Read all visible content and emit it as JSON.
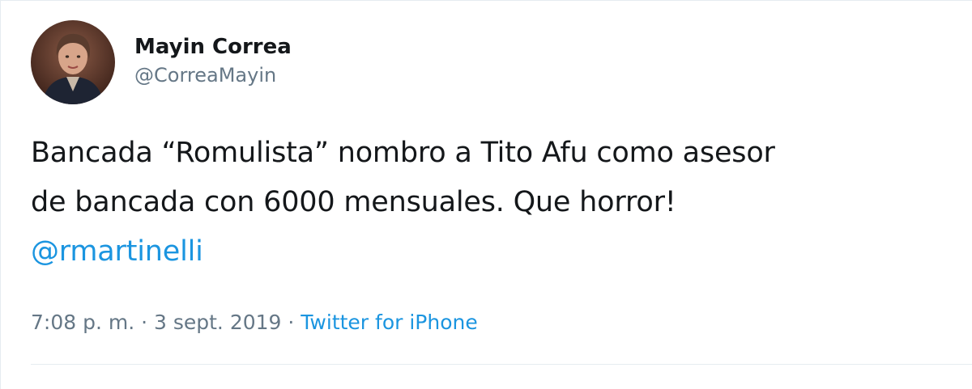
{
  "user": {
    "display_name": "Mayin Correa",
    "handle": "@CorreaMayin"
  },
  "tweet": {
    "line1": "Bancada “Romulista” nombro a Tito Afu como asesor",
    "line2": "de bancada con 6000 mensuales. Que horror!",
    "mention": "@rmartinelli"
  },
  "meta": {
    "time": "7:08 p. m.",
    "separator1": " · ",
    "date": "3 sept. 2019",
    "separator2": " · ",
    "source": "Twitter for iPhone"
  },
  "colors": {
    "link": "#1b95e0",
    "text": "#14171a",
    "muted": "#657786"
  },
  "icons": {
    "avatar": "profile-photo"
  }
}
